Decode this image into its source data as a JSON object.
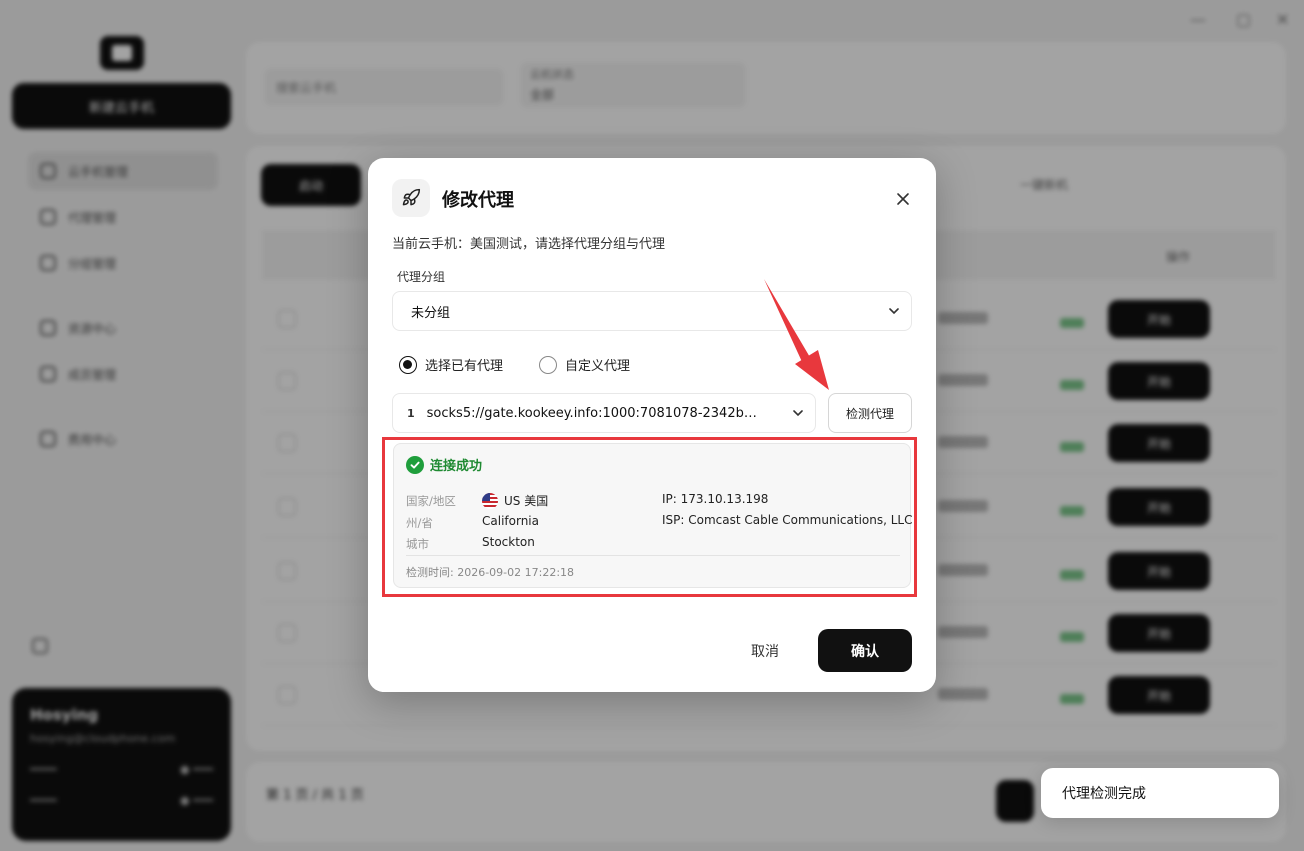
{
  "background": {
    "new_button": "新建云手机",
    "sidebar": [
      {
        "label": "云手机管理"
      },
      {
        "label": "代理管理"
      },
      {
        "label": "分组管理"
      },
      {
        "label": "资源中心"
      },
      {
        "label": "成员管理"
      },
      {
        "label": "费用中心"
      }
    ],
    "search_placeholder": "搜索云手机",
    "filter_label": "云机状态",
    "filter_value": "全部",
    "start_button": "启动",
    "batch_label": "一键新机",
    "header_op": "操作",
    "row_op": "开始",
    "user": {
      "name": "Hosying",
      "email": "hosying@cloudphone.com"
    },
    "footer_text": "第 1 页 / 共 1 页"
  },
  "modal": {
    "title": "修改代理",
    "icon": "rocket-icon",
    "description": "当前云手机：美国测试，请选择代理分组与代理",
    "group_label": "代理分组",
    "group_value": "未分组",
    "radio_existing": "选择已有代理",
    "radio_custom": "自定义代理",
    "selected_radio": "existing",
    "proxy_index": "1",
    "proxy_value": "socks5://gate.kookeey.info:1000:7081078-2342b…",
    "check_button": "检测代理",
    "result": {
      "status": "连接成功",
      "country_label": "国家/地区",
      "country_value": "US 美国",
      "state_label": "州/省",
      "state_value": "California",
      "city_label": "城市",
      "city_value": "Stockton",
      "ip": "IP: 173.10.13.198",
      "isp": "ISP: Comcast Cable Communications, LLC",
      "checked_at": "检测时间: 2026-09-02 17:22:18"
    },
    "cancel": "取消",
    "confirm": "确认"
  },
  "toast": "代理检测完成",
  "colors": {
    "accent": "#111111",
    "success": "#1f9e3c",
    "highlight": "#e8383d"
  }
}
